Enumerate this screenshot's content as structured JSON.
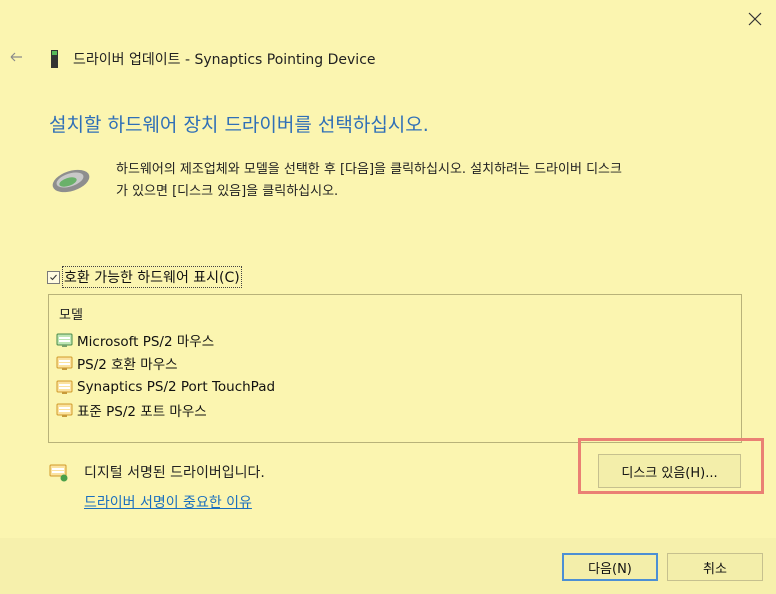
{
  "window": {
    "title": "드라이버 업데이트 - Synaptics Pointing Device",
    "close_icon": "close-icon",
    "back_icon": "back-arrow-icon"
  },
  "heading": "설치할 하드웨어 장치 드라이버를 선택하십시오.",
  "description": {
    "line1": "하드웨어의 제조업체와 모델을 선택한 후 [다음]을 클릭하십시오. 설치하려는 드라이버 디스크",
    "line2": "가 있으면 [디스크 있음]을 클릭하십시오."
  },
  "compatible_checkbox": {
    "label": "호환 가능한 하드웨어 표시(C)",
    "checked": true
  },
  "model_list": {
    "header": "모델",
    "items": [
      {
        "label": "Microsoft PS/2 마우스",
        "icon": "device-icon-green"
      },
      {
        "label": "PS/2 호환 마우스",
        "icon": "device-icon-orange"
      },
      {
        "label": "Synaptics PS/2 Port TouchPad",
        "icon": "device-icon-orange"
      },
      {
        "label": "표준 PS/2 포트 마우스",
        "icon": "device-icon-orange"
      }
    ]
  },
  "signed": {
    "text": "디지털 서명된 드라이버입니다.",
    "link": "드라이버 서명이 중요한 이유"
  },
  "buttons": {
    "have_disk": "디스크 있음(H)...",
    "next": "다음(N)",
    "cancel": "취소"
  },
  "colors": {
    "background": "#fbf5b0",
    "heading": "#2f6fb7",
    "link": "#1a6fbf",
    "highlight": "#ea8074",
    "focus_border": "#4c8fd4"
  }
}
